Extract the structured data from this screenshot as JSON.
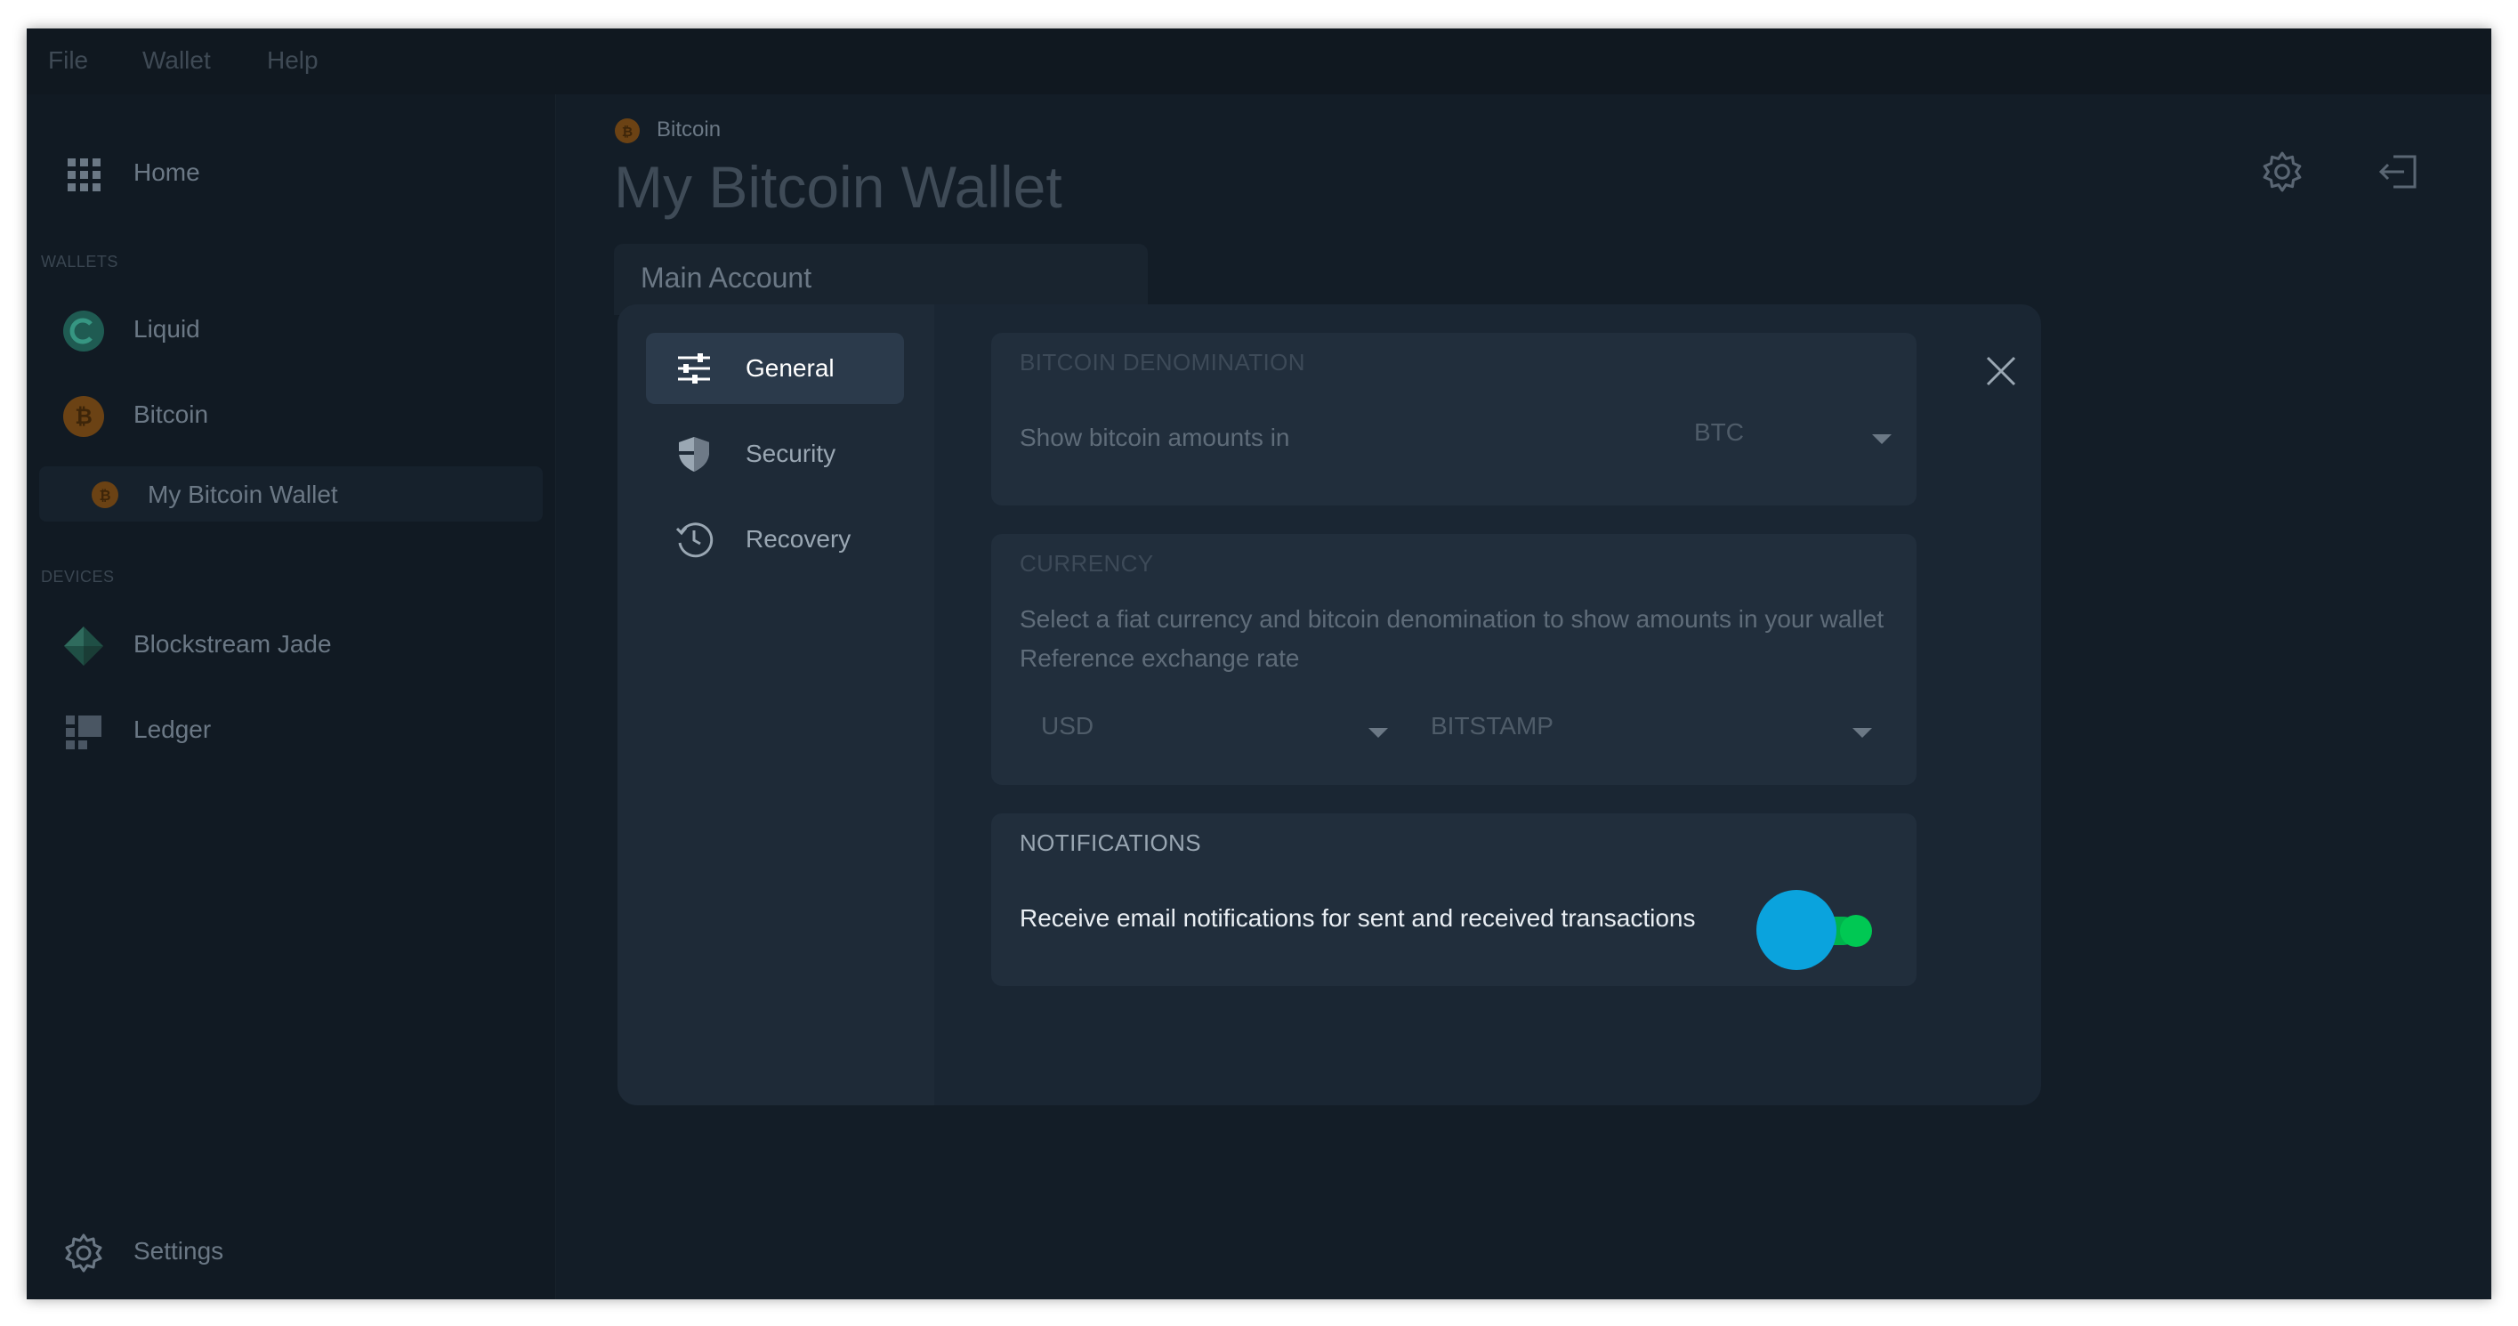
{
  "menubar": {
    "items": [
      "File",
      "Wallet",
      "Help"
    ]
  },
  "sidebar": {
    "home_label": "Home",
    "wallets_section": "WALLETS",
    "wallets": [
      {
        "label": "Liquid",
        "icon": "liquid-icon"
      },
      {
        "label": "Bitcoin",
        "icon": "bitcoin-icon"
      }
    ],
    "selected_wallet": "My Bitcoin Wallet",
    "devices_section": "DEVICES",
    "devices": [
      {
        "label": "Blockstream Jade",
        "icon": "jade-icon"
      },
      {
        "label": "Ledger",
        "icon": "ledger-icon"
      }
    ],
    "settings_label": "Settings"
  },
  "header": {
    "network": "Bitcoin",
    "title": "My Bitcoin Wallet",
    "account_tab": "Main Account"
  },
  "settings_modal": {
    "nav": [
      {
        "label": "General",
        "icon": "sliders-icon",
        "active": true
      },
      {
        "label": "Security",
        "icon": "shield-icon",
        "active": false
      },
      {
        "label": "Recovery",
        "icon": "history-icon",
        "active": false
      }
    ],
    "denomination": {
      "title": "BITCOIN DENOMINATION",
      "label": "Show bitcoin amounts in",
      "value": "BTC"
    },
    "currency": {
      "title": "CURRENCY",
      "description": "Select a fiat currency and bitcoin denomination to show amounts in your wallet",
      "exchange_label": "Reference exchange rate",
      "fiat": "USD",
      "exchange": "BITSTAMP"
    },
    "notifications": {
      "title": "NOTIFICATIONS",
      "label": "Receive email notifications for sent and received transactions",
      "enabled": true
    }
  },
  "colors": {
    "background": "#131d27",
    "modal": "#1a2633",
    "toggle_knob": "#0aa3dd",
    "toggle_on": "#00c853",
    "bitcoin": "#f7931a",
    "liquid": "#46bea4"
  }
}
